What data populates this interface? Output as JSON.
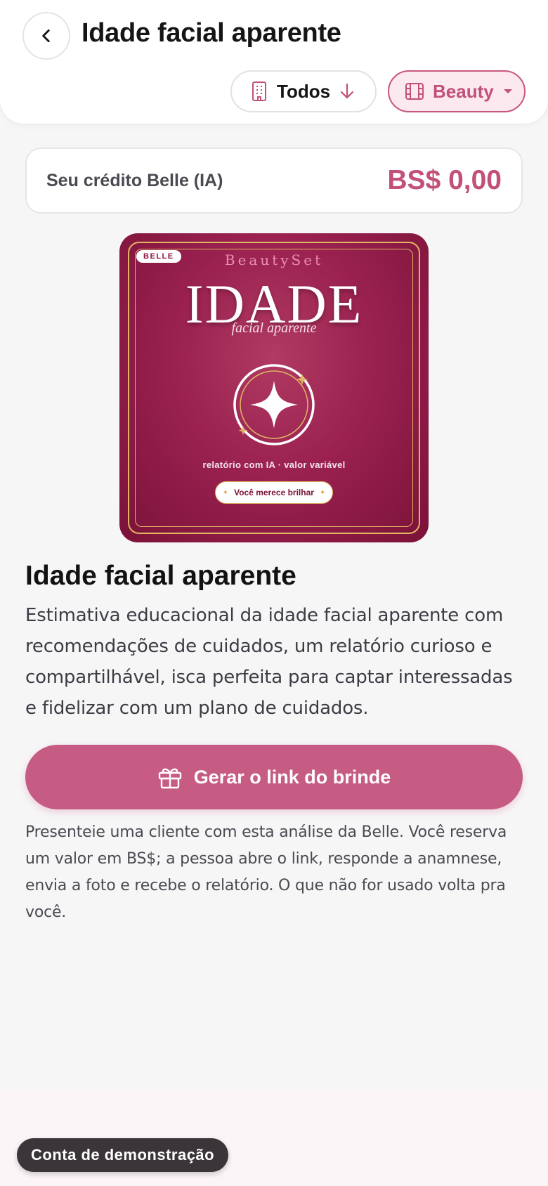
{
  "header": {
    "title": "Idade facial aparente",
    "back_icon": "chevron-left-icon",
    "filters": {
      "todos_label": "Todos",
      "todos_icon": "building-icon",
      "sort_icon": "arrow-down-icon",
      "beauty_label": "Beauty",
      "beauty_icon": "film-icon",
      "dropdown_icon": "caret-down-icon"
    }
  },
  "credit": {
    "label": "Seu crédito Belle (IA)",
    "value": "BS$ 0,00"
  },
  "hero": {
    "badge": "BELLE",
    "brand": "BeautySet",
    "title": "IDADE",
    "subtitle": "facial aparente",
    "caption": "relatório com IA · valor variável",
    "pill": "Você merece brilhar",
    "emblem_icon": "sparkle-star-icon"
  },
  "product": {
    "title": "Idade facial aparente",
    "description": "Estimativa educacional da idade facial aparente com recomendações de cuidados, um relatório curioso e compartilhável, isca perfeita para captar interessadas e fidelizar com um plano de cuidados."
  },
  "cta": {
    "label": "Gerar o link do brinde",
    "icon": "gift-icon"
  },
  "note": "Presenteie uma cliente com esta análise da Belle. Você reserva um valor em BS$; a pessoa abre o link, responde a anamnese, envia a foto e recebe o relatório. O que não for usado volta pra você.",
  "demo_badge": "Conta de demonstração",
  "colors": {
    "accent": "#c65b84",
    "accent_text": "#c2507a",
    "hero_background": "#9a2150",
    "gold": "#e0b561",
    "background": "#f7f6f7"
  }
}
